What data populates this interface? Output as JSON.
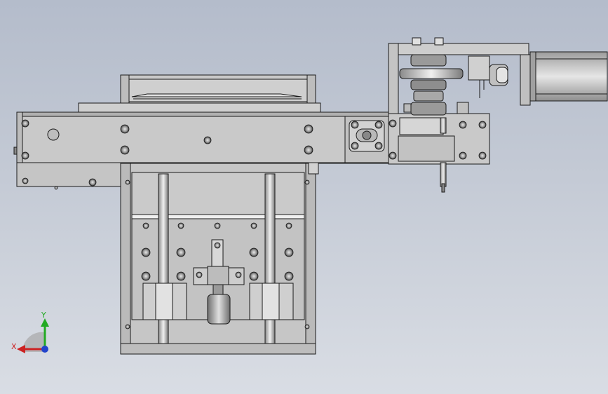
{
  "view": {
    "background_top": "#b4bccb",
    "background_bottom": "#d9dde4",
    "part_fill": "#c9c9c9",
    "part_fill_light": "#d8d8d8",
    "part_fill_dark": "#a9a9a9",
    "edge_color": "#1a1a1a"
  },
  "triad": {
    "x_label": "X",
    "y_label": "Y",
    "x_color": "#cc2222",
    "y_color": "#22aa22",
    "z_color": "#2244cc"
  }
}
